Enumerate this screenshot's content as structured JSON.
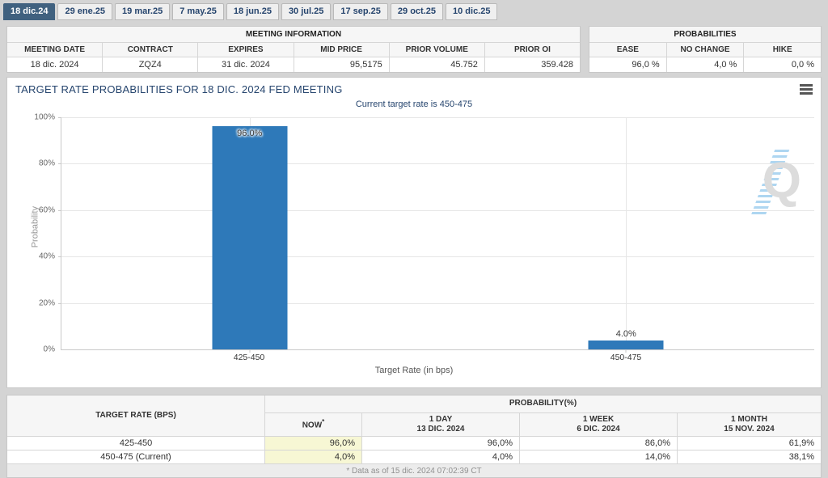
{
  "tabs": [
    {
      "label": "18 dic.24",
      "active": true
    },
    {
      "label": "29 ene.25",
      "active": false
    },
    {
      "label": "19 mar.25",
      "active": false
    },
    {
      "label": "7 may.25",
      "active": false
    },
    {
      "label": "18 jun.25",
      "active": false
    },
    {
      "label": "30 jul.25",
      "active": false
    },
    {
      "label": "17 sep.25",
      "active": false
    },
    {
      "label": "29 oct.25",
      "active": false
    },
    {
      "label": "10 dic.25",
      "active": false
    }
  ],
  "meeting_info": {
    "title": "MEETING INFORMATION",
    "columns": [
      "MEETING DATE",
      "CONTRACT",
      "EXPIRES",
      "MID PRICE",
      "PRIOR VOLUME",
      "PRIOR OI"
    ],
    "values": [
      "18 dic. 2024",
      "ZQZ4",
      "31 dic. 2024",
      "95,5175",
      "45.752",
      "359.428"
    ]
  },
  "probabilities": {
    "title": "PROBABILITIES",
    "columns": [
      "EASE",
      "NO CHANGE",
      "HIKE"
    ],
    "values": [
      "96,0 %",
      "4,0 %",
      "0,0 %"
    ]
  },
  "chart": {
    "title": "TARGET RATE PROBABILITIES FOR 18 DIC. 2024 FED MEETING",
    "subtitle": "Current target rate is 450-475",
    "ylabel": "Probability",
    "xlabel": "Target Rate (in bps)",
    "yticks": [
      "100%",
      "80%",
      "60%",
      "40%",
      "20%",
      "0%"
    ],
    "menu_icon": "hamburger-icon",
    "watermark_letter": "Q"
  },
  "chart_data": {
    "type": "bar",
    "title": "TARGET RATE PROBABILITIES FOR 18 DIC. 2024 FED MEETING",
    "subtitle": "Current target rate is 450-475",
    "categories": [
      "425-450",
      "450-475"
    ],
    "values": [
      96.0,
      4.0
    ],
    "bar_labels": [
      "96.0%",
      "4.0%"
    ],
    "xlabel": "Target Rate (in bps)",
    "ylabel": "Probability",
    "ylim": [
      0,
      100
    ],
    "ytick_step": 20,
    "grid": true,
    "legend": "none",
    "bar_color": "#2e79b9"
  },
  "history_table": {
    "rate_header": "TARGET RATE (BPS)",
    "prob_header": "PROBABILITY(%)",
    "now_label": "NOW",
    "now_sup": "*",
    "period_cols": [
      {
        "label": "1 DAY",
        "date": "13 DIC. 2024"
      },
      {
        "label": "1 WEEK",
        "date": "6 DIC. 2024"
      },
      {
        "label": "1 MONTH",
        "date": "15 NOV. 2024"
      }
    ],
    "rows": [
      {
        "rate": "425-450",
        "now": "96,0%",
        "day": "96,0%",
        "week": "86,0%",
        "month": "61,9%"
      },
      {
        "rate": "450-475 (Current)",
        "now": "4,0%",
        "day": "4,0%",
        "week": "14,0%",
        "month": "38,1%"
      }
    ],
    "footnote": "* Data as of 15 dic. 2024 07:02:39 CT"
  },
  "colors": {
    "bar_blue": "#2e79b9",
    "active_tab": "#40617f",
    "navy_text": "#26456e",
    "highlight_yellow": "#f7f7d4",
    "page_background": "#d4d4d4"
  }
}
